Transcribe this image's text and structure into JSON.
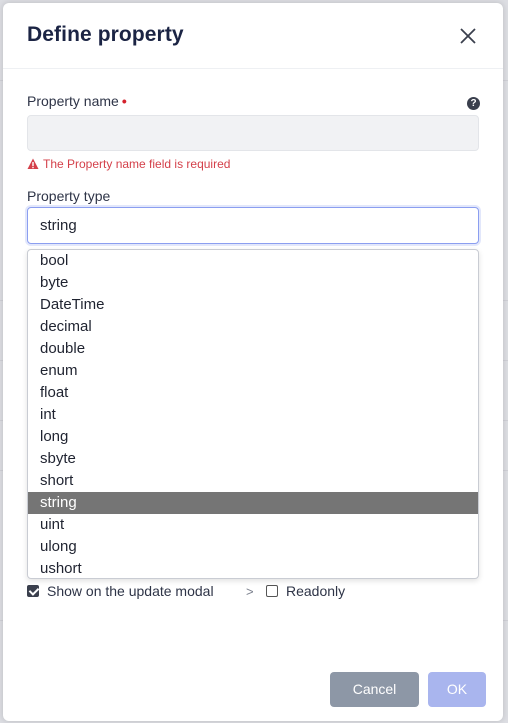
{
  "modal": {
    "title": "Define property",
    "close_icon": "close-icon"
  },
  "property_name": {
    "label": "Property name",
    "required_marker": "•",
    "help_icon": "?",
    "value": "",
    "error": "The Property name field is required"
  },
  "property_type": {
    "label": "Property type",
    "value": "string",
    "options": [
      "bool",
      "byte",
      "DateTime",
      "decimal",
      "double",
      "enum",
      "float",
      "int",
      "long",
      "sbyte",
      "short",
      "string",
      "uint",
      "ulong",
      "ushort"
    ],
    "selected_index": 11
  },
  "options_row": {
    "show_on_update_modal": {
      "label": "Show on the update modal",
      "checked": true
    },
    "chevron": ">",
    "readonly": {
      "label": "Readonly",
      "checked": false
    }
  },
  "footer": {
    "cancel_label": "Cancel",
    "ok_label": "OK"
  },
  "colors": {
    "title": "#1b2444",
    "error": "#d4404a",
    "focus_border": "#8b9ef0",
    "selected_option_bg": "#757575",
    "cancel_bg": "#8d97a6",
    "ok_bg": "#a9b5ee"
  }
}
